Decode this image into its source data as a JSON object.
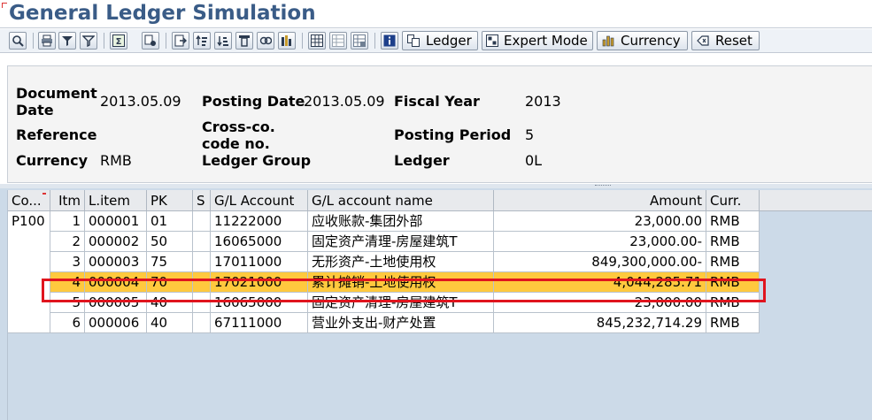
{
  "title": "General Ledger Simulation",
  "toolbar": {
    "icons": [
      "details-icon",
      "print-icon",
      "filter-icon",
      "set-filter-icon",
      "sum-icon",
      "subtotal-icon",
      "export-icon",
      "sort-asc-icon",
      "sort-desc-icon",
      "find-icon",
      "find-next-icon",
      "layout-icon",
      "grid-icon",
      "select-layout-icon",
      "save-layout-icon",
      "info-icon"
    ],
    "ledger_label": "Ledger",
    "expert_mode_label": "Expert Mode",
    "currency_label": "Currency",
    "reset_label": "Reset"
  },
  "header": {
    "document_date_label_1": "Document",
    "document_date_label_2": "Date",
    "document_date": "2013.05.09",
    "posting_date_label": "Posting Date",
    "posting_date": "2013.05.09",
    "fiscal_year_label": "Fiscal Year",
    "fiscal_year": "2013",
    "reference_label": "Reference",
    "reference": "",
    "cross_co_label_1": "Cross-co.",
    "cross_co_label_2": "code no.",
    "cross_co": "",
    "posting_period_label": "Posting Period",
    "posting_period": "5",
    "currency_label": "Currency",
    "currency": "RMB",
    "ledger_group_label": "Ledger Group",
    "ledger_group": "",
    "ledger_label": "Ledger",
    "ledger": "0L"
  },
  "table": {
    "columns": [
      "Co...",
      "Itm",
      "L.item",
      "PK",
      "S",
      "G/L Account",
      "G/L account name",
      "Amount",
      "Curr."
    ],
    "company_code": "P100",
    "rows": [
      {
        "itm": "1",
        "litem": "000001",
        "pk": "01",
        "s": "",
        "gl": "11222000",
        "name": "应收账款-集团外部",
        "amount": "23,000.00",
        "curr": "RMB",
        "selected": false
      },
      {
        "itm": "2",
        "litem": "000002",
        "pk": "50",
        "s": "",
        "gl": "16065000",
        "name": "固定资产清理-房屋建筑T",
        "amount": "23,000.00-",
        "curr": "RMB",
        "selected": false
      },
      {
        "itm": "3",
        "litem": "000003",
        "pk": "75",
        "s": "",
        "gl": "17011000",
        "name": "无形资产-土地使用权",
        "amount": "849,300,000.00-",
        "curr": "RMB",
        "selected": false
      },
      {
        "itm": "4",
        "litem": "000004",
        "pk": "70",
        "s": "",
        "gl": "17021000",
        "name": "累计摊销-土地使用权",
        "amount": "4,044,285.71",
        "curr": "RMB",
        "selected": true
      },
      {
        "itm": "5",
        "litem": "000005",
        "pk": "40",
        "s": "",
        "gl": "16065000",
        "name": "固定资产清理-房屋建筑T",
        "amount": "23,000.00",
        "curr": "RMB",
        "selected": false
      },
      {
        "itm": "6",
        "litem": "000006",
        "pk": "40",
        "s": "",
        "gl": "67111000",
        "name": "营业外支出-财产处置",
        "amount": "845,232,714.29",
        "curr": "RMB",
        "selected": false
      }
    ]
  },
  "colors": {
    "title": "#3a5c87",
    "selected_row": "#ffc93e",
    "highlight_box": "#e0141e",
    "grid_background": "#ccdae8"
  }
}
